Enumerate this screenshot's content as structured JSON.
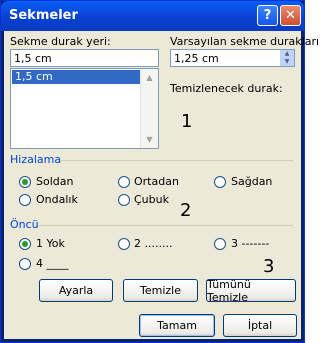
{
  "window": {
    "title": "Sekmeler"
  },
  "titlebar_buttons": {
    "help": "?",
    "close": "✕"
  },
  "tabstop": {
    "label": "Sekme durak yeri:",
    "value": "1,5 cm",
    "list_items": [
      "1,5 cm"
    ]
  },
  "default_tabs": {
    "label": "Varsayılan sekme durakları:",
    "value": "1,25 cm"
  },
  "clear_label": "Temizlenecek durak:",
  "alignment": {
    "title": "Hizalama",
    "options": [
      {
        "label": "Soldan",
        "checked": true
      },
      {
        "label": "Ortadan",
        "checked": false
      },
      {
        "label": "Sağdan",
        "checked": false
      },
      {
        "label": "Ondalık",
        "checked": false
      },
      {
        "label": "Çubuk",
        "checked": false
      }
    ]
  },
  "leader": {
    "title": "Öncü",
    "options": [
      {
        "label": "1 Yok",
        "checked": true
      },
      {
        "label": "2 ........",
        "checked": false
      },
      {
        "label": "3 -------",
        "checked": false
      },
      {
        "label": "4 ____",
        "checked": false
      }
    ]
  },
  "annotations": {
    "n1": "1",
    "n2": "2",
    "n3": "3"
  },
  "buttons": {
    "set": "Ayarla",
    "clear": "Temizle",
    "clear_all": "Tümünü Temizle",
    "ok": "Tamam",
    "cancel": "İptal"
  }
}
